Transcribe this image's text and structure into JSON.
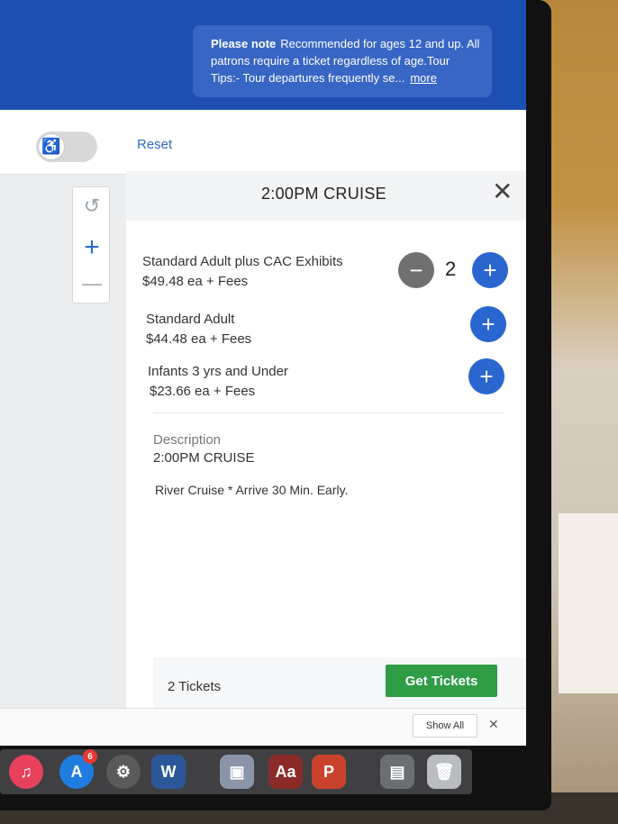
{
  "notice": {
    "label": "Please note",
    "text": "Recommended for ages 12 and up. All patrons require a ticket regardless of age.Tour Tips:- Tour departures frequently se...",
    "more_link": "more"
  },
  "toolbar": {
    "reset_label": "Reset"
  },
  "panel": {
    "title": "2:00PM CRUISE",
    "tickets": [
      {
        "name": "Standard Adult plus CAC Exhibits",
        "price": "$49.48 ea + Fees",
        "quantity": "2"
      },
      {
        "name": "Standard Adult",
        "price": "$44.48 ea + Fees"
      },
      {
        "name": "Infants 3 yrs and Under",
        "price": "$23.66 ea + Fees"
      }
    ],
    "description_label": "Description",
    "description_title": "2:00PM CRUISE",
    "description_body": "River Cruise * Arrive 30 Min. Early.",
    "tickets_count": "2 Tickets",
    "get_tickets_label": "Get Tickets"
  },
  "bottom_bar": {
    "show_all_label": "Show All"
  },
  "dock": {
    "app_store_badge": "6",
    "word_label": "W",
    "dictionary_label": "Aa",
    "powerpoint_label": "P"
  },
  "colors": {
    "brand_blue": "#1d4fb3",
    "plus_button": "#2a66cf",
    "get_tickets_green": "#2e9d45"
  }
}
